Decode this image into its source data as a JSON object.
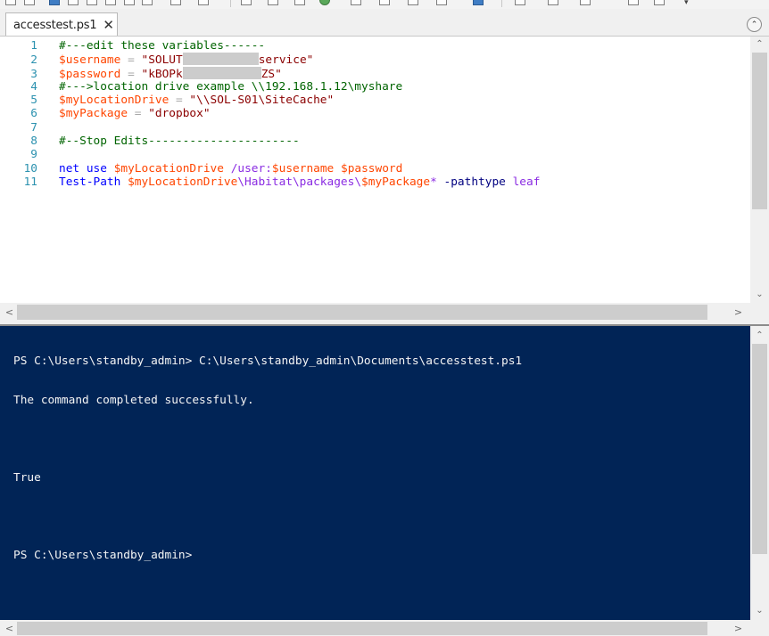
{
  "toolbar": {
    "visible": true
  },
  "tabs": [
    {
      "label": "accesstest.ps1",
      "close_glyph": "✕",
      "active": true
    }
  ],
  "collapse_glyph": "⌃",
  "editor": {
    "lines": [
      {
        "n": "1",
        "tokens": [
          {
            "t": "#---edit these variables------",
            "c": "comment"
          }
        ]
      },
      {
        "n": "2",
        "tokens": [
          {
            "t": "$username",
            "c": "var"
          },
          {
            "t": " ",
            "c": "plain"
          },
          {
            "t": "=",
            "c": "op"
          },
          {
            "t": " \"SOLUT",
            "c": "str"
          },
          {
            "t": "",
            "c": "redact"
          },
          {
            "t": "service\"",
            "c": "str"
          }
        ]
      },
      {
        "n": "3",
        "tokens": [
          {
            "t": "$password",
            "c": "var"
          },
          {
            "t": " ",
            "c": "plain"
          },
          {
            "t": "=",
            "c": "op"
          },
          {
            "t": " \"kBOPk",
            "c": "str"
          },
          {
            "t": "",
            "c": "redact-short"
          },
          {
            "t": "ZS\"",
            "c": "str"
          }
        ]
      },
      {
        "n": "4",
        "tokens": [
          {
            "t": "#--->location drive example \\\\192.168.1.12\\myshare",
            "c": "comment"
          }
        ]
      },
      {
        "n": "5",
        "tokens": [
          {
            "t": "$myLocationDrive",
            "c": "var"
          },
          {
            "t": " ",
            "c": "plain"
          },
          {
            "t": "=",
            "c": "op"
          },
          {
            "t": " \"\\\\SOL-S01\\SiteCache\"",
            "c": "str"
          }
        ]
      },
      {
        "n": "6",
        "tokens": [
          {
            "t": "$myPackage",
            "c": "var"
          },
          {
            "t": " ",
            "c": "plain"
          },
          {
            "t": "=",
            "c": "op"
          },
          {
            "t": " \"dropbox\"",
            "c": "str"
          }
        ]
      },
      {
        "n": "7",
        "tokens": []
      },
      {
        "n": "8",
        "tokens": [
          {
            "t": "#--Stop Edits----------------------",
            "c": "comment"
          }
        ]
      },
      {
        "n": "9",
        "tokens": []
      },
      {
        "n": "10",
        "tokens": [
          {
            "t": "net",
            "c": "cmd"
          },
          {
            "t": " ",
            "c": "plain"
          },
          {
            "t": "use",
            "c": "cmd"
          },
          {
            "t": " ",
            "c": "plain"
          },
          {
            "t": "$myLocationDrive",
            "c": "var"
          },
          {
            "t": " ",
            "c": "plain"
          },
          {
            "t": "/user:",
            "c": "arg"
          },
          {
            "t": "$username",
            "c": "var"
          },
          {
            "t": " ",
            "c": "plain"
          },
          {
            "t": "$password",
            "c": "var"
          }
        ]
      },
      {
        "n": "11",
        "tokens": [
          {
            "t": "Test-Path",
            "c": "cmd"
          },
          {
            "t": " ",
            "c": "plain"
          },
          {
            "t": "$myLocationDrive",
            "c": "var"
          },
          {
            "t": "\\Habitat\\packages\\",
            "c": "arg"
          },
          {
            "t": "$myPackage",
            "c": "var"
          },
          {
            "t": "*",
            "c": "arg"
          },
          {
            "t": " ",
            "c": "plain"
          },
          {
            "t": "-pathtype",
            "c": "param"
          },
          {
            "t": " ",
            "c": "plain"
          },
          {
            "t": "leaf",
            "c": "arg"
          }
        ]
      }
    ]
  },
  "console": {
    "lines": [
      "PS C:\\Users\\standby_admin> C:\\Users\\standby_admin\\Documents\\accesstest.ps1",
      "The command completed successfully.",
      "",
      "True",
      "",
      "PS C:\\Users\\standby_admin>"
    ]
  },
  "scrollbars": {
    "up": "⌃",
    "down": "⌄",
    "left": "<",
    "right": ">"
  },
  "colors": {
    "console_bg": "#012456",
    "comment": "#006400",
    "variable": "#ff4500",
    "string": "#8b0000",
    "command": "#0000ff",
    "line_number": "#2b91af"
  }
}
